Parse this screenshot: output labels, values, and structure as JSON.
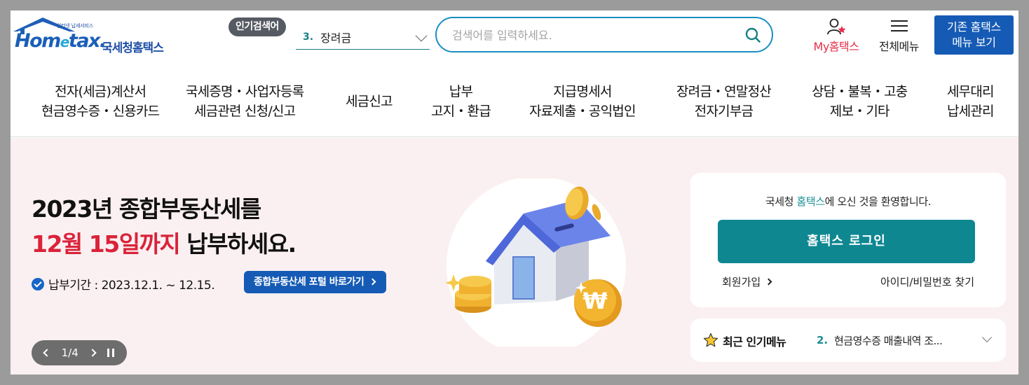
{
  "header": {
    "logo": {
      "tagline": "인터넷 납세서비스",
      "wordmark_a": "Hom",
      "wordmark_e": "e",
      "wordmark_b": "tax.",
      "korean_name": "국세청홈택스"
    },
    "popular": {
      "badge": "인기검색어",
      "rank": "3.",
      "term": "장려금"
    },
    "search": {
      "placeholder": "검색어를 입력하세요."
    },
    "my_hometax_label": "My홈택스",
    "all_menu_label": "전체메뉴",
    "old_home_line1": "기존 홈택스",
    "old_home_line2": "메뉴 보기"
  },
  "nav": [
    {
      "line1": "전자(세금)계산서",
      "line2": "현금영수증・신용카드"
    },
    {
      "line1": "국세증명・사업자등록",
      "line2": "세금관련 신청/신고"
    },
    {
      "line1": "세금신고",
      "line2": ""
    },
    {
      "line1": "납부",
      "line2": "고지・환급"
    },
    {
      "line1": "지급명세서",
      "line2": "자료제출・공익법인"
    },
    {
      "line1": "장려금・연말정산",
      "line2": "전자기부금"
    },
    {
      "line1": "상담・불복・고충",
      "line2": "제보・기타"
    },
    {
      "line1": "세무대리",
      "line2": "납세관리"
    }
  ],
  "hero": {
    "title1": "2023년 종합부동산세를",
    "title2_red": "12월 15일까지",
    "title2_rest": " 납부하세요.",
    "period": "납부기간 : 2023.12.1. ~ 12.15.",
    "portal_button": "종합부동산세 포털 바로가기",
    "pager": "1/4"
  },
  "login": {
    "welcome_pre": "국세청 ",
    "welcome_hl": "홈택스",
    "welcome_post": "에 오신 것을 환영합니다.",
    "login_button": "홈택스 로그인",
    "join": "회원가입",
    "find": "아이디/비밀번호 찾기"
  },
  "recent": {
    "title": "최근 인기메뉴",
    "rank": "2.",
    "value": "현금영수증 매출내역 조..."
  },
  "colors": {
    "brand_blue": "#155bb5",
    "teal": "#0e8791",
    "red": "#d9233a"
  }
}
